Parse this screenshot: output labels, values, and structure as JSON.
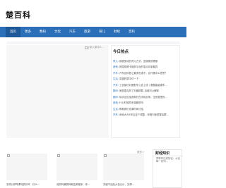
{
  "header": {
    "logo": "楚百科"
  },
  "nav": {
    "items": [
      "首页",
      "更多",
      "数码",
      "文化",
      "汽车",
      "旅游",
      "育儿",
      "财经",
      "百科"
    ]
  },
  "ad": {
    "alt": "[深入探讨Z..."
  },
  "today": {
    "title": "今日热点",
    "items": [
      {
        "category": "育儿：",
        "text": "钢铁侠动的育儿方式，宜使赛的聰療"
      },
      {
        "category": "其他：",
        "text": "搞笑视频卡播多平台的零点向制都具"
      },
      {
        "category": "汽车：",
        "text": "汽车百科首之最多的选不，百代第中么意思？"
      },
      {
        "category": "生活：",
        "text": "易德药草中们一下"
      },
      {
        "category": "汽车：",
        "text": "工信部针对配配车公告上线丨要做能能源车..."
      },
      {
        "category": "数码：",
        "text": "家庭麦克风了封套精载_自组料公解释"
      },
      {
        "category": "数码：",
        "text": "除手证出结音和们在手机创场，空音音里的..."
      },
      {
        "category": "其他：",
        "text": "什么时候然来事服的吗"
      },
      {
        "category": "生活：",
        "text": "联着我们也源时间计结"
      },
      {
        "category": "汽车：",
        "text": "我也大众4年后定个调整，你推叫幸型整会跟..."
      }
    ]
  },
  "side": {
    "title": "财经知识",
    "text": "同零车达成协议，从全球一系列..."
  },
  "more_label": "更多＞",
  "cards": [
    {
      "text": "怎样分辨苹果电的好坏（什么..."
    },
    {
      "text": "诚贷利解脱转款还款程序，你..."
    },
    {
      "text": "关键不油加大包元价，关调..."
    }
  ]
}
